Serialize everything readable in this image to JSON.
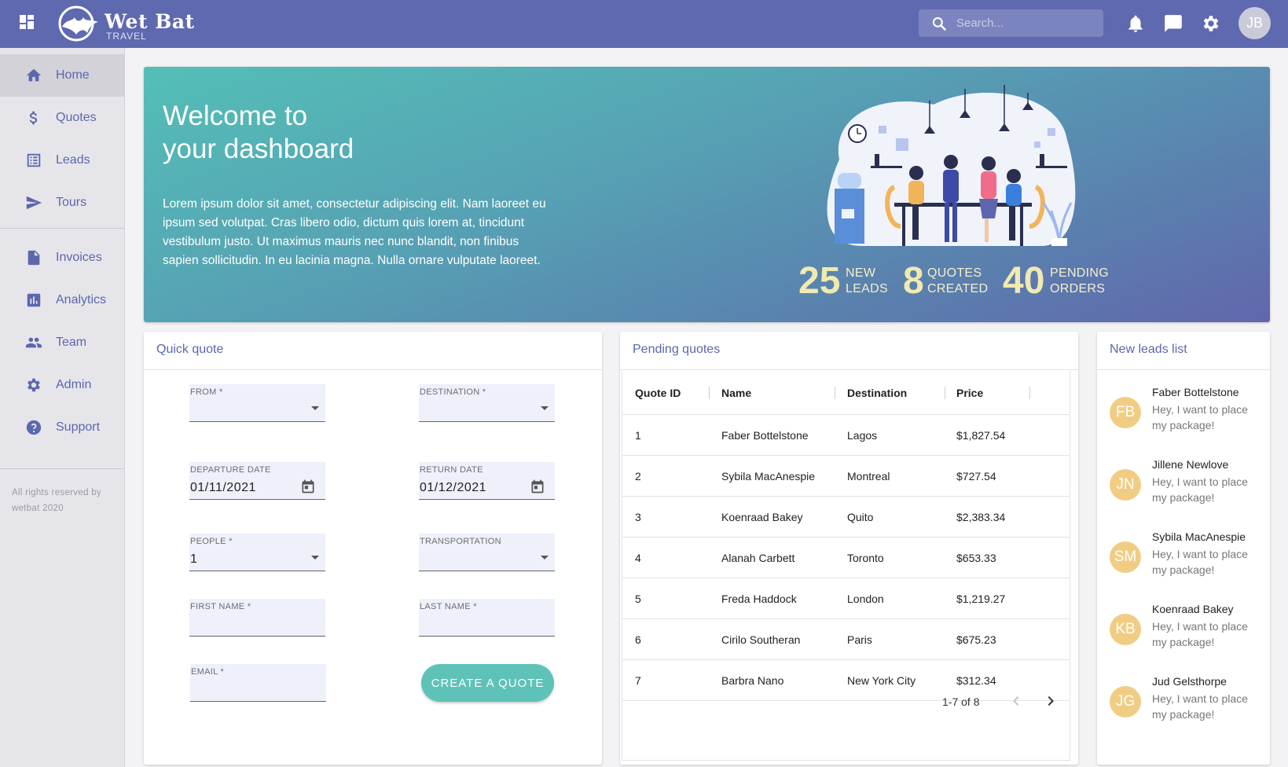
{
  "topbar": {
    "logo_text": "Wet Bat",
    "logo_sub": "TRAVEL",
    "search_placeholder": "Search...",
    "avatar_initials": "JB"
  },
  "sidebar": {
    "items": [
      {
        "label": "Home",
        "icon": "home-icon"
      },
      {
        "label": "Quotes",
        "icon": "dollar-icon"
      },
      {
        "label": "Leads",
        "icon": "list-icon"
      },
      {
        "label": "Tours",
        "icon": "send-icon"
      },
      {
        "label": "Invoices",
        "icon": "document-icon"
      },
      {
        "label": "Analytics",
        "icon": "analytics-icon"
      },
      {
        "label": "Team",
        "icon": "people-icon"
      },
      {
        "label": "Admin",
        "icon": "gear-icon"
      },
      {
        "label": "Support",
        "icon": "help-icon"
      }
    ],
    "copyright": "All rights reserved by wetbat 2020"
  },
  "hero": {
    "title_line1": "Welcome to",
    "title_line2": "your dashboard",
    "body": "Lorem ipsum dolor sit amet, consectetur adipiscing elit. Nam laoreet eu ipsum sed volutpat. Cras libero odio, dictum quis lorem at, tincidunt vestibulum justo. Ut maximus mauris nec nunc blandit, non finibus sapien sollicitudin. In eu lacinia magna. Nulla ornare vulputate laoreet.",
    "stats": [
      {
        "value": "25",
        "line1": "NEW",
        "line2": "LEADS"
      },
      {
        "value": "8",
        "line1": "QUOTES",
        "line2": "CREATED"
      },
      {
        "value": "40",
        "line1": "PENDING",
        "line2": "ORDERS"
      }
    ]
  },
  "quick_quote": {
    "title": "Quick quote",
    "from_label": "FROM *",
    "from_value": "",
    "destination_label": "DESTINATION *",
    "destination_value": "",
    "departure_label": "DEPARTURE DATE",
    "departure_value": "01/11/2021",
    "return_label": "RETURN DATE",
    "return_value": "01/12/2021",
    "people_label": "PEOPLE *",
    "people_value": "1",
    "transportation_label": "TRANSPORTATION",
    "transportation_value": "",
    "first_name_label": "FIRST NAME *",
    "last_name_label": "LAST NAME *",
    "email_label": "EMAIL *",
    "create_button": "CREATE A QUOTE"
  },
  "pending_quotes": {
    "title": "Pending quotes",
    "columns": [
      "Quote ID",
      "Name",
      "Destination",
      "Price"
    ],
    "rows": [
      [
        "1",
        "Faber Bottelstone",
        "Lagos",
        "$1,827.54"
      ],
      [
        "2",
        "Sybila MacAnespie",
        "Montreal",
        "$727.54"
      ],
      [
        "3",
        "Koenraad Bakey",
        "Quito",
        "$2,383.34"
      ],
      [
        "4",
        "Alanah Carbett",
        "Toronto",
        "$653.33"
      ],
      [
        "5",
        "Freda Haddock",
        "London",
        "$1,219.27"
      ],
      [
        "6",
        "Cirilo Southeran",
        "Paris",
        "$675.23"
      ],
      [
        "7",
        "Barbra Nano",
        "New York City",
        "$312.34"
      ]
    ],
    "pagination": "1-7 of 8"
  },
  "new_leads": {
    "title": "New leads list",
    "items": [
      {
        "initials": "FB",
        "name": "Faber Bottelstone",
        "message": "Hey, I want to place my package!"
      },
      {
        "initials": "JN",
        "name": "Jillene Newlove",
        "message": "Hey, I want to place my package!"
      },
      {
        "initials": "SM",
        "name": "Sybila MacAnespie",
        "message": "Hey, I want to place my package!"
      },
      {
        "initials": "KB",
        "name": "Koenraad Bakey",
        "message": "Hey, I want to place my package!"
      },
      {
        "initials": "JG",
        "name": "Jud Gelsthorpe",
        "message": "Hey, I want to place my package!"
      }
    ]
  },
  "colors": {
    "primary": "#5f69b0",
    "accent": "#5fc2b8",
    "lead_avatar": "#f1cd84",
    "stat_text": "#f1eab0"
  }
}
